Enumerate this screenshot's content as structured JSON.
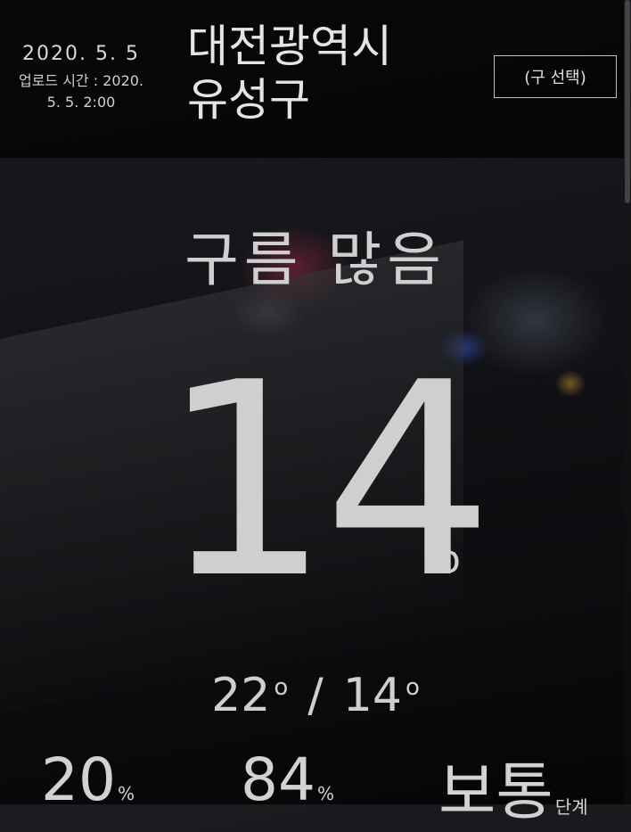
{
  "header": {
    "date": "2020. 5. 5",
    "upload_label": "업로드 시간 : 2020.",
    "upload_time": "5. 5. 2:00",
    "city_line1": "대전광역시",
    "city_line2": "유성구",
    "select_button": "(구 선택)"
  },
  "weather": {
    "condition": "구름 많음",
    "temperature": "14",
    "degree_symbol": "o",
    "high": "22",
    "low": "14",
    "separator": "/"
  },
  "stats": {
    "rain_value": "20",
    "rain_unit": "%",
    "humidity_value": "84",
    "humidity_unit": "%",
    "dust_value": "보통",
    "dust_unit": "단계"
  },
  "colors": {
    "text": "#d4d4d4",
    "header_bg": "rgba(0,0,0,0.72)"
  }
}
